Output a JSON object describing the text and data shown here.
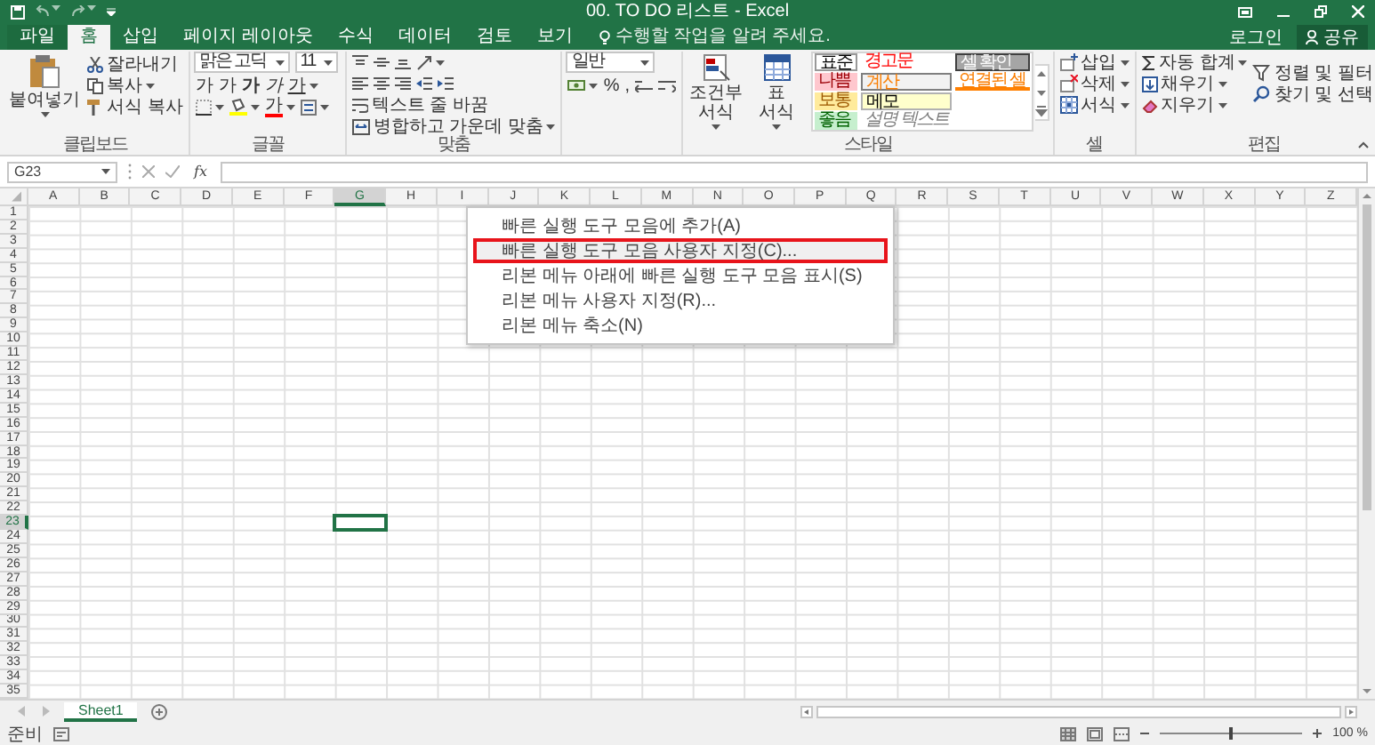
{
  "window": {
    "title": "00. TO DO 리스트 - Excel"
  },
  "tabs": [
    {
      "label": "파일",
      "selected": false
    },
    {
      "label": "홈",
      "selected": true
    },
    {
      "label": "삽입",
      "selected": false
    },
    {
      "label": "페이지 레이아웃",
      "selected": false
    },
    {
      "label": "수식",
      "selected": false
    },
    {
      "label": "데이터",
      "selected": false
    },
    {
      "label": "검토",
      "selected": false
    },
    {
      "label": "보기",
      "selected": false
    }
  ],
  "tell_me": {
    "placeholder": "수행할 작업을 알려 주세요."
  },
  "account": {
    "sign_in": "로그인",
    "share": "공유"
  },
  "ribbon": {
    "clipboard": {
      "label": "클립보드",
      "paste": "붙여넣기",
      "cut": "잘라내기",
      "copy": "복사",
      "format_painter": "서식 복사"
    },
    "font": {
      "label": "글꼴",
      "font_name": "맑은 고딕",
      "font_size": "11",
      "grow": "가",
      "shrink": "가",
      "bold": "가",
      "italic": "가",
      "underline": "가",
      "font_color": "가"
    },
    "alignment": {
      "label": "맞춤",
      "wrap_text": "텍스트 줄 바꿈",
      "merge_center": "병합하고 가운데 맞춤"
    },
    "number": {
      "format": "일반",
      "percent": "%",
      "comma": ","
    },
    "styles": {
      "label": "스타일",
      "conditional": "조건부 서식",
      "format_table": "표 서식",
      "cells": [
        {
          "label": "표준",
          "kind": "normal"
        },
        {
          "label": "나쁨",
          "kind": "bad"
        },
        {
          "label": "보통",
          "kind": "neutral"
        },
        {
          "label": "좋음",
          "kind": "good"
        },
        {
          "label": "경고문",
          "kind": "warning"
        },
        {
          "label": "계산",
          "kind": "calculation"
        },
        {
          "label": "메모",
          "kind": "note"
        },
        {
          "label": "설명 텍스트",
          "kind": "explanatory"
        },
        {
          "label": "셀 확인",
          "kind": "check"
        },
        {
          "label": "연결된 셀",
          "kind": "linked"
        }
      ]
    },
    "cells": {
      "label": "셀",
      "insert": "삽입",
      "delete": "삭제",
      "format": "서식"
    },
    "editing": {
      "label": "편집",
      "autosum": "자동 합계",
      "fill": "채우기",
      "clear": "지우기",
      "sort_filter": "정렬 및 필터",
      "find_select": "찾기 및 선택"
    }
  },
  "context_menu": {
    "items": [
      {
        "label": "빠른 실행 도구 모음에 추가(A)",
        "highlighted": false
      },
      {
        "label": "빠른 실행 도구 모음 사용자 지정(C)...",
        "highlighted": true
      },
      {
        "label": "리본 메뉴 아래에 빠른 실행 도구 모음 표시(S)",
        "highlighted": false
      },
      {
        "label": "리본 메뉴 사용자 지정(R)...",
        "highlighted": false
      },
      {
        "label": "리본 메뉴 축소(N)",
        "highlighted": false
      }
    ]
  },
  "formula_bar": {
    "name_box": "G23",
    "function_label": "fx"
  },
  "sheet": {
    "columns": [
      {
        "label": "A",
        "selected": false
      },
      {
        "label": "B",
        "selected": false
      },
      {
        "label": "C",
        "selected": false
      },
      {
        "label": "D",
        "selected": false
      },
      {
        "label": "E",
        "selected": false
      },
      {
        "label": "F",
        "selected": false
      },
      {
        "label": "G",
        "selected": true
      },
      {
        "label": "H",
        "selected": false
      },
      {
        "label": "I",
        "selected": false
      },
      {
        "label": "J",
        "selected": false
      },
      {
        "label": "K",
        "selected": false
      },
      {
        "label": "L",
        "selected": false
      },
      {
        "label": "M",
        "selected": false
      },
      {
        "label": "N",
        "selected": false
      },
      {
        "label": "O",
        "selected": false
      },
      {
        "label": "P",
        "selected": false
      },
      {
        "label": "Q",
        "selected": false
      },
      {
        "label": "R",
        "selected": false
      },
      {
        "label": "S",
        "selected": false
      },
      {
        "label": "T",
        "selected": false
      },
      {
        "label": "U",
        "selected": false
      },
      {
        "label": "V",
        "selected": false
      },
      {
        "label": "W",
        "selected": false
      },
      {
        "label": "X",
        "selected": false
      },
      {
        "label": "Y",
        "selected": false
      },
      {
        "label": "Z",
        "selected": false
      }
    ],
    "rows": [
      {
        "label": "1",
        "selected": false
      },
      {
        "label": "2",
        "selected": false
      },
      {
        "label": "3",
        "selected": false
      },
      {
        "label": "4",
        "selected": false
      },
      {
        "label": "5",
        "selected": false
      },
      {
        "label": "6",
        "selected": false
      },
      {
        "label": "7",
        "selected": false
      },
      {
        "label": "8",
        "selected": false
      },
      {
        "label": "9",
        "selected": false
      },
      {
        "label": "10",
        "selected": false
      },
      {
        "label": "11",
        "selected": false
      },
      {
        "label": "12",
        "selected": false
      },
      {
        "label": "13",
        "selected": false
      },
      {
        "label": "14",
        "selected": false
      },
      {
        "label": "15",
        "selected": false
      },
      {
        "label": "16",
        "selected": false
      },
      {
        "label": "17",
        "selected": false
      },
      {
        "label": "18",
        "selected": false
      },
      {
        "label": "19",
        "selected": false
      },
      {
        "label": "20",
        "selected": false
      },
      {
        "label": "21",
        "selected": false
      },
      {
        "label": "22",
        "selected": false
      },
      {
        "label": "23",
        "selected": true
      },
      {
        "label": "24",
        "selected": false
      },
      {
        "label": "25",
        "selected": false
      },
      {
        "label": "26",
        "selected": false
      },
      {
        "label": "27",
        "selected": false
      },
      {
        "label": "28",
        "selected": false
      },
      {
        "label": "29",
        "selected": false
      },
      {
        "label": "30",
        "selected": false
      },
      {
        "label": "31",
        "selected": false
      },
      {
        "label": "32",
        "selected": false
      },
      {
        "label": "33",
        "selected": false
      },
      {
        "label": "34",
        "selected": false
      },
      {
        "label": "35",
        "selected": false
      }
    ]
  },
  "sheet_tabs": [
    {
      "label": "Sheet1",
      "selected": true
    }
  ],
  "status_bar": {
    "status": "준비",
    "zoom": {
      "level": 0.5
    },
    "zoom_label": "100 %"
  }
}
